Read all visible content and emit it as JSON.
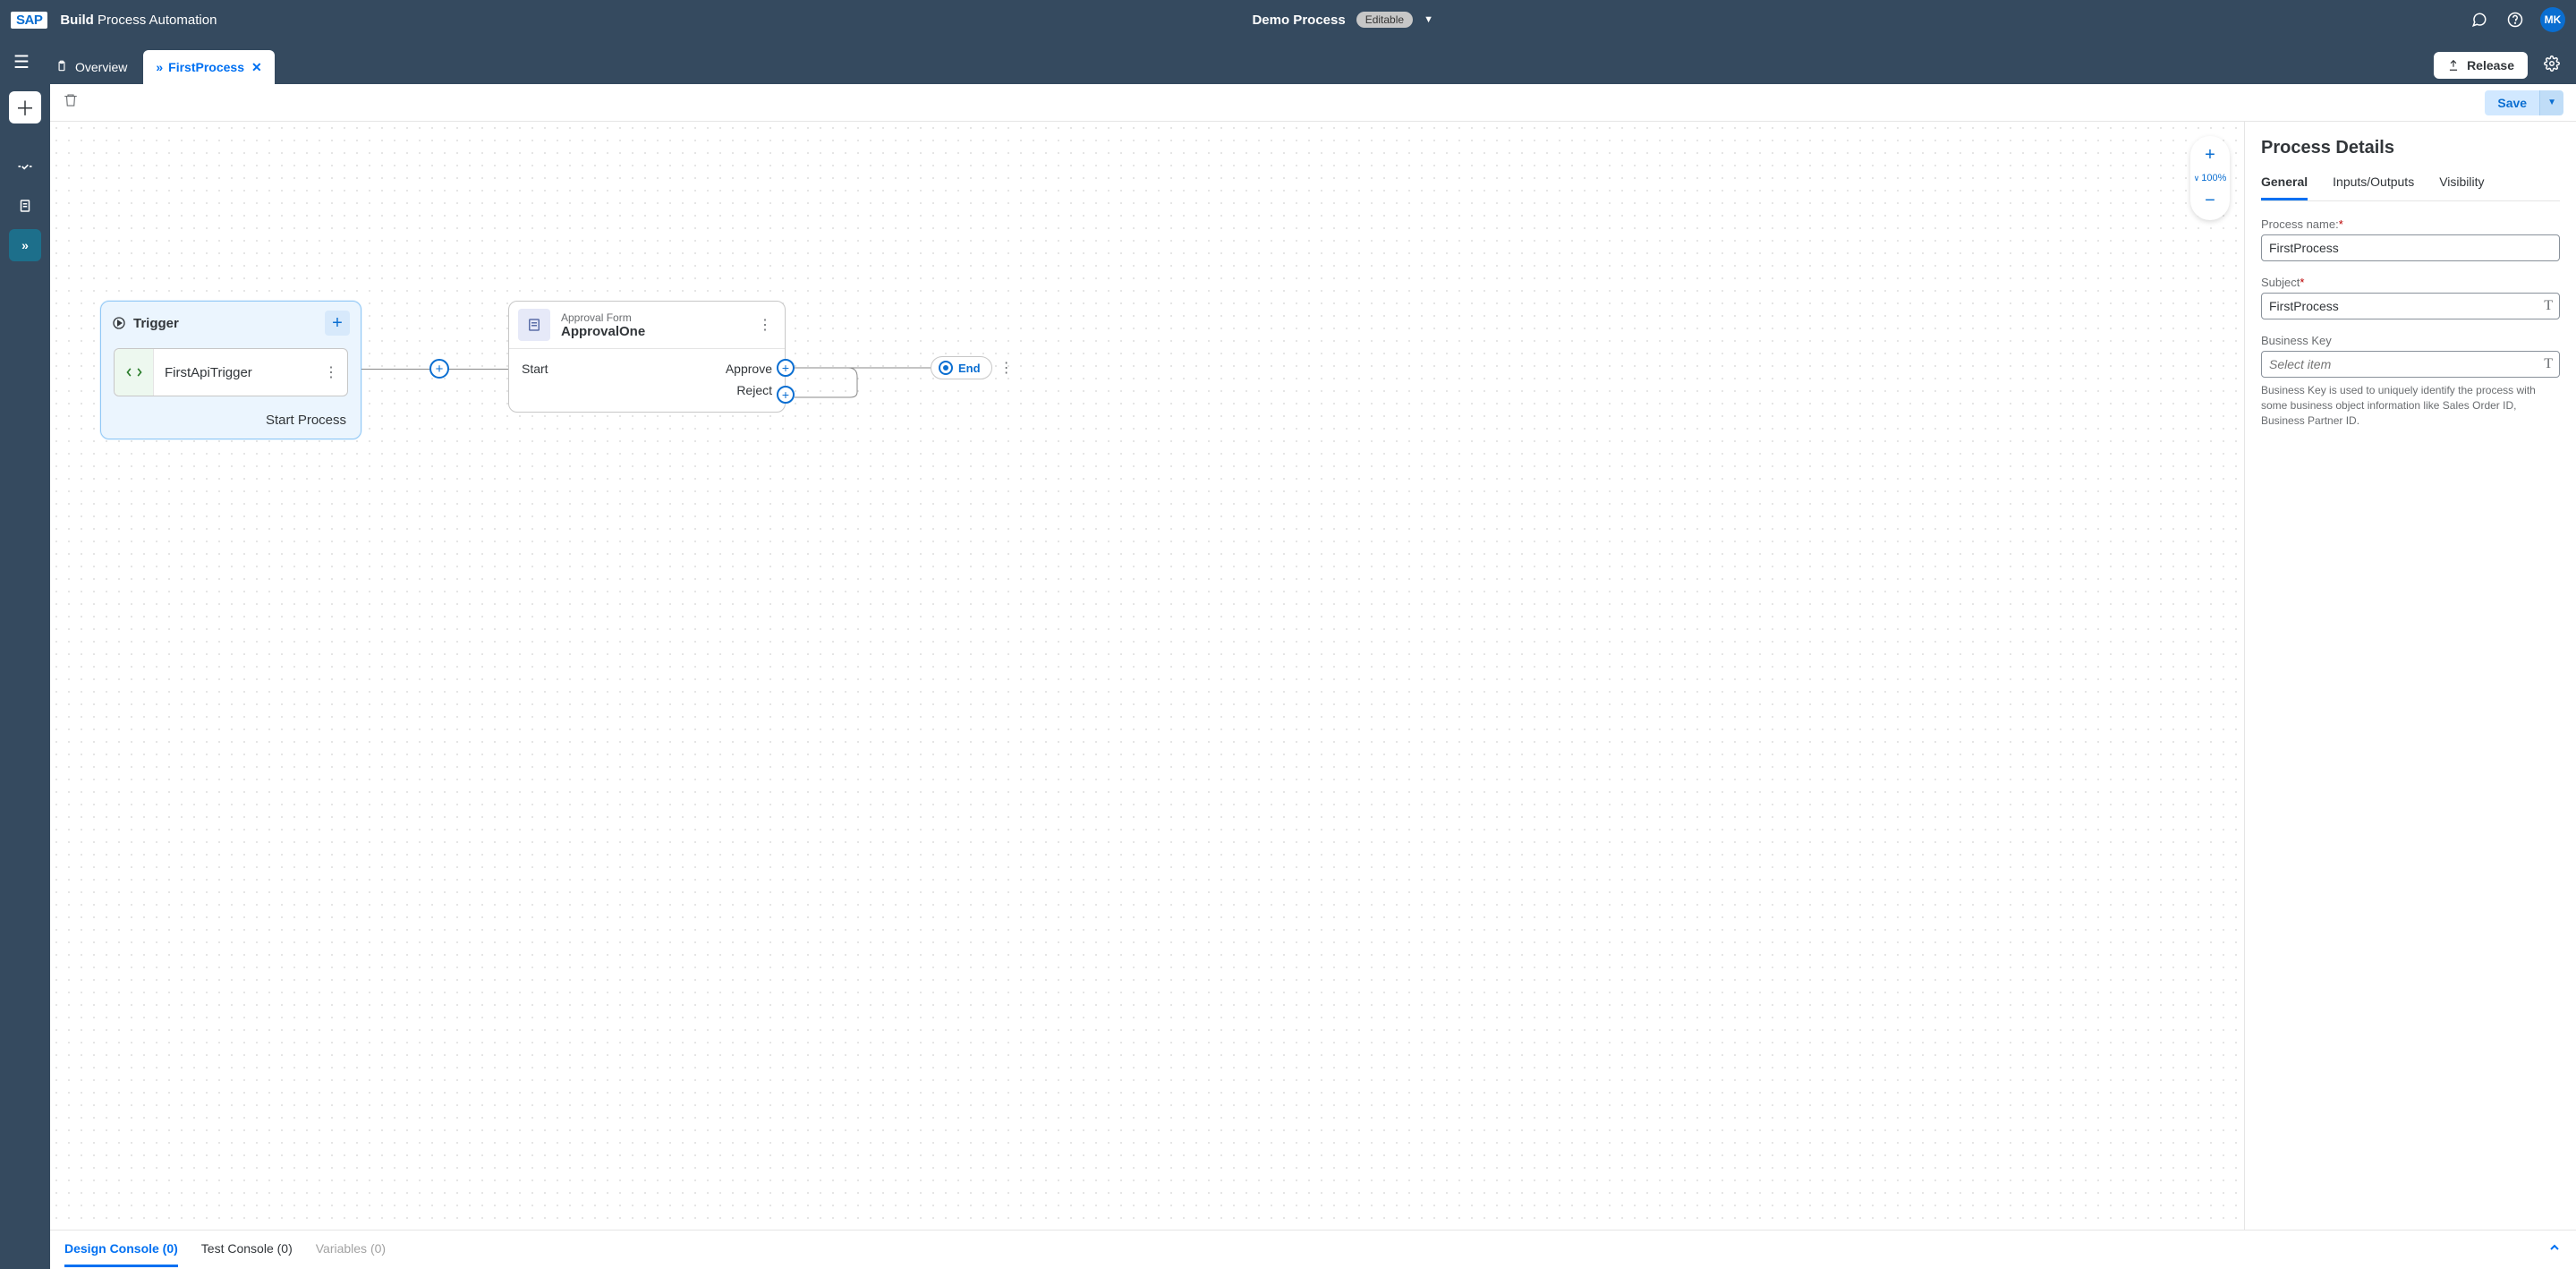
{
  "shell": {
    "logo": "SAP",
    "app_name_bold": "Build",
    "app_name": "Process Automation",
    "process_title": "Demo Process",
    "status_pill": "Editable",
    "avatar_initials": "MK"
  },
  "toolbar": {
    "overview_label": "Overview",
    "tab_label": "FirstProcess",
    "release_label": "Release"
  },
  "editor_bar": {
    "save_label": "Save"
  },
  "zoom": {
    "level": "100%"
  },
  "nodes": {
    "trigger": {
      "title": "Trigger",
      "item_name": "FirstApiTrigger",
      "footer": "Start Process"
    },
    "approval": {
      "type_label": "Approval Form",
      "name": "ApprovalOne",
      "port_in": "Start",
      "port_out1": "Approve",
      "port_out2": "Reject"
    },
    "end": {
      "label": "End"
    }
  },
  "details": {
    "title": "Process Details",
    "tabs": {
      "general": "General",
      "io": "Inputs/Outputs",
      "visibility": "Visibility"
    },
    "process_name_label": "Process name:",
    "process_name_value": "FirstProcess",
    "subject_label": "Subject",
    "subject_value": "FirstProcess",
    "business_key_label": "Business Key",
    "business_key_placeholder": "Select item",
    "business_key_help": "Business Key is used to uniquely identify the process with some business object information like Sales Order ID, Business Partner ID."
  },
  "bottom": {
    "design_console": "Design Console (0)",
    "test_console": "Test Console (0)",
    "variables": "Variables (0)"
  }
}
